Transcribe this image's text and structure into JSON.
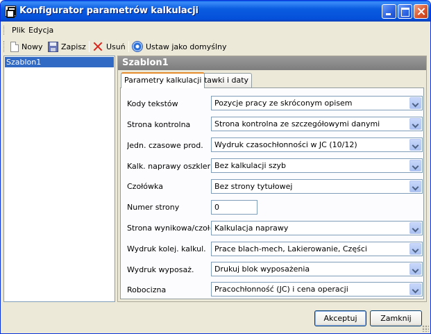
{
  "window": {
    "title": "Konfigurator parametrów kalkulacji"
  },
  "menu": {
    "items": [
      "Plik",
      "Edycja"
    ]
  },
  "toolbar": {
    "new_label": "Nowy",
    "save_label": "Zapisz",
    "delete_label": "Usuń",
    "default_label": "Ustaw jako domyślny"
  },
  "templates": {
    "items": [
      {
        "label": "Szablon1",
        "selected": true
      }
    ]
  },
  "panel": {
    "title": "Szablon1"
  },
  "tabs": [
    {
      "label": "Parametry kalkulacji",
      "active": true
    },
    {
      "label": "Stawki i daty",
      "active": false
    }
  ],
  "form": {
    "rows": [
      {
        "label": "Kody tekstów",
        "type": "combo",
        "value": "Pozycje pracy ze skróconym opisem"
      },
      {
        "label": "Strona kontrolna",
        "type": "combo",
        "value": "Strona kontrolna ze szczegółowymi danymi"
      },
      {
        "label": "Jedn. czasowe prod.",
        "type": "combo",
        "value": "Wydruk czasochłonności w JC (10/12)"
      },
      {
        "label": "Kalk. naprawy oszklenia",
        "type": "combo",
        "value": "Bez kalkulacji szyb"
      },
      {
        "label": "Czołówka",
        "type": "combo",
        "value": "Bez strony tytułowej"
      },
      {
        "label": "Numer strony",
        "type": "text",
        "value": "0"
      },
      {
        "label": "Strona wynikowa/czołówka",
        "type": "combo",
        "value": "Kalkulacja naprawy"
      },
      {
        "label": "Wydruk kolej. kalkul.",
        "type": "combo",
        "value": "Prace blach-mech, Lakierowanie, Części"
      },
      {
        "label": "Wydruk wyposaż.",
        "type": "combo",
        "value": "Drukuj blok wyposażenia"
      },
      {
        "label": "Robocizna",
        "type": "combo",
        "value": "Pracochłonność (JC) i cena operacji"
      }
    ]
  },
  "buttons": {
    "accept_label": "Akceptuj",
    "close_label": "Zamknij"
  }
}
